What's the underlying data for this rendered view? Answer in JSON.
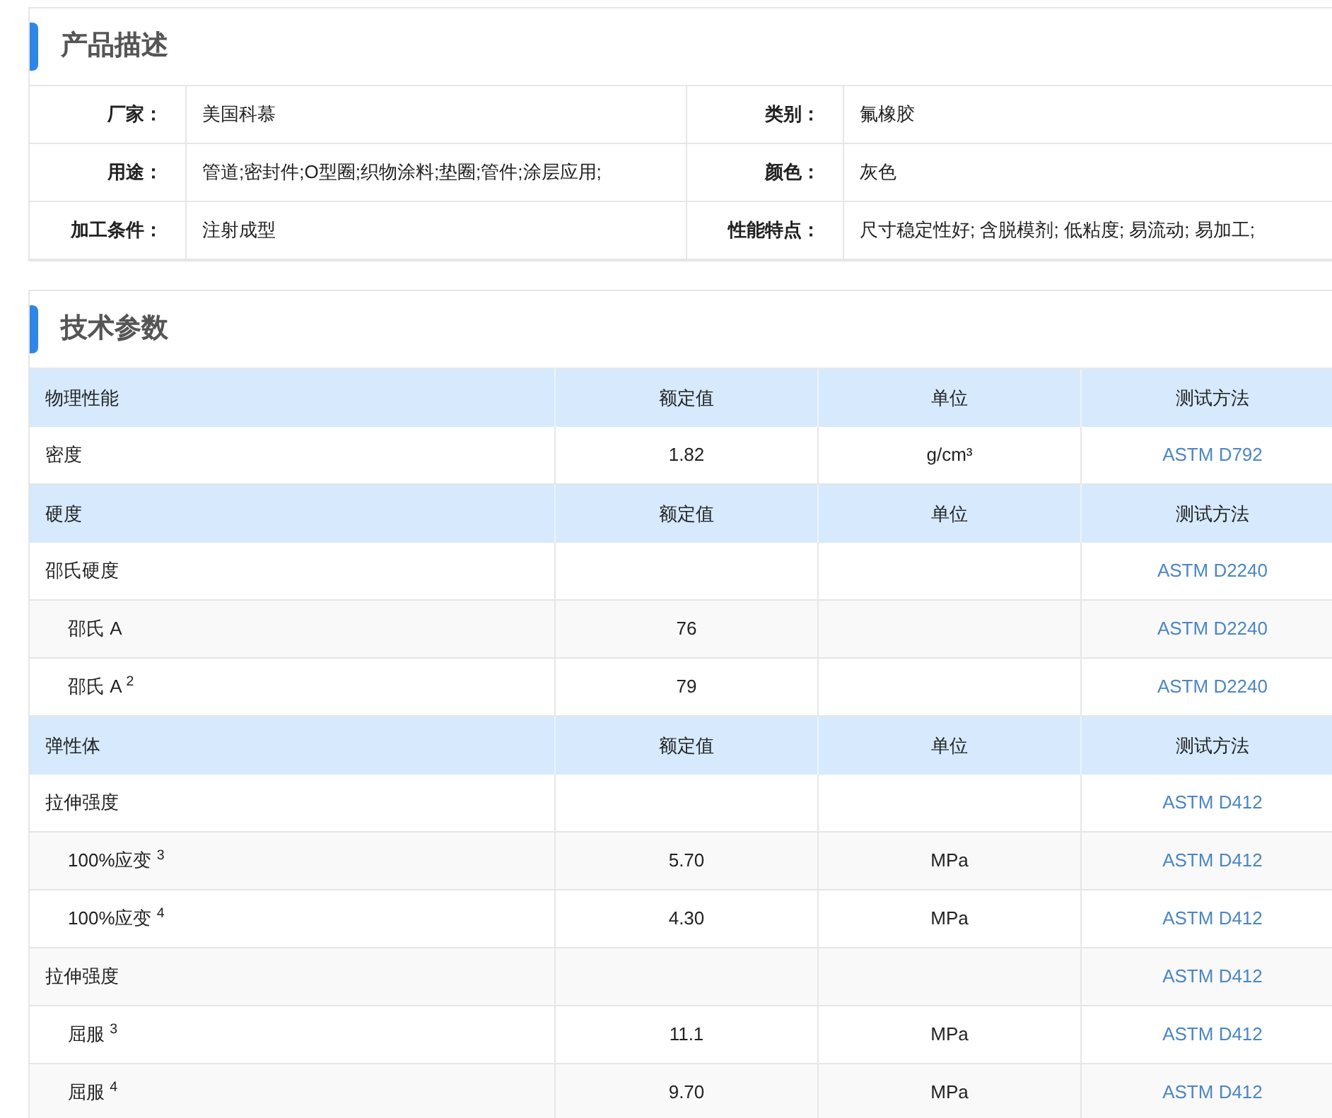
{
  "description": {
    "title": "产品描述",
    "rows": [
      [
        {
          "label": "厂家：",
          "value": "美国科慕"
        },
        {
          "label": "类别：",
          "value": "氟橡胶"
        }
      ],
      [
        {
          "label": "用途：",
          "value": "管道;密封件;O型圈;织物涂料;垫圈;管件;涂层应用;"
        },
        {
          "label": "颜色：",
          "value": "灰色"
        }
      ],
      [
        {
          "label": "加工条件：",
          "value": "注射成型"
        },
        {
          "label": "性能特点：",
          "value": "尺寸稳定性好; 含脱模剂; 低粘度; 易流动; 易加工;"
        }
      ]
    ]
  },
  "specs": {
    "title": "技术参数",
    "groups": [
      {
        "header": [
          "物理性能",
          "额定值",
          "单位",
          "测试方法"
        ],
        "rows": [
          {
            "name": "密度",
            "value": "1.82",
            "unit": "g/cm³",
            "method": "ASTM D792"
          }
        ]
      },
      {
        "header": [
          "硬度",
          "额定值",
          "单位",
          "测试方法"
        ],
        "rows": [
          {
            "name": "邵氏硬度",
            "method": "ASTM D2240",
            "children": [
              {
                "name": "邵氏 A",
                "value": "76",
                "method": "ASTM D2240"
              },
              {
                "name": "邵氏 A $^{2}$",
                "value": "79",
                "method": "ASTM D2240"
              }
            ]
          }
        ]
      },
      {
        "header": [
          "弹性体",
          "额定值",
          "单位",
          "测试方法"
        ],
        "rows": [
          {
            "name": "拉伸强度",
            "method": "ASTM D412",
            "children": [
              {
                "name": "100%应变 $^{3}$",
                "value": "5.70",
                "unit": "MPa",
                "method": "ASTM D412"
              },
              {
                "name": "100%应变 $^{4}$",
                "value": "4.30",
                "unit": "MPa",
                "method": "ASTM D412"
              }
            ]
          },
          {
            "name": "拉伸强度",
            "method": "ASTM D412",
            "children": [
              {
                "name": "屈服 $^{3}$",
                "value": "11.1",
                "unit": "MPa",
                "method": "ASTM D412"
              },
              {
                "name": "屈服 $^{4}$",
                "value": "9.70",
                "unit": "MPa",
                "method": "ASTM D412"
              }
            ]
          }
        ]
      }
    ]
  }
}
